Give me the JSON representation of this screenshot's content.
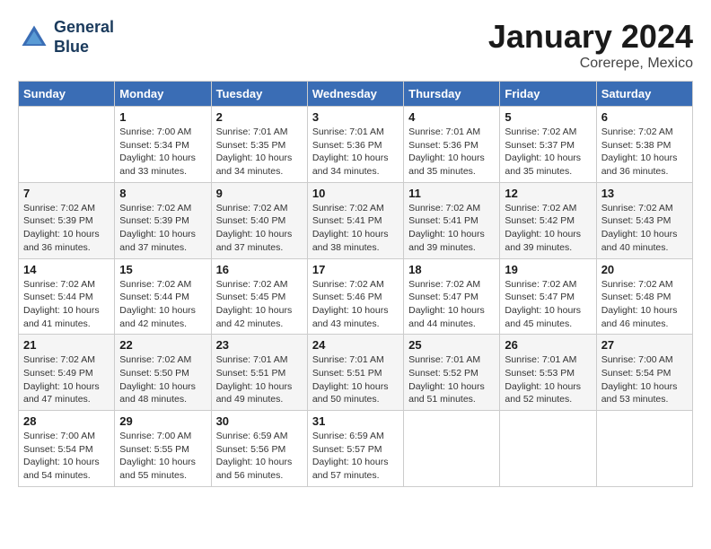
{
  "header": {
    "logo_line1": "General",
    "logo_line2": "Blue",
    "month_title": "January 2024",
    "location": "Corerepe, Mexico"
  },
  "weekdays": [
    "Sunday",
    "Monday",
    "Tuesday",
    "Wednesday",
    "Thursday",
    "Friday",
    "Saturday"
  ],
  "weeks": [
    [
      {
        "day": "",
        "sunrise": "",
        "sunset": "",
        "daylight": ""
      },
      {
        "day": "1",
        "sunrise": "Sunrise: 7:00 AM",
        "sunset": "Sunset: 5:34 PM",
        "daylight": "Daylight: 10 hours and 33 minutes."
      },
      {
        "day": "2",
        "sunrise": "Sunrise: 7:01 AM",
        "sunset": "Sunset: 5:35 PM",
        "daylight": "Daylight: 10 hours and 34 minutes."
      },
      {
        "day": "3",
        "sunrise": "Sunrise: 7:01 AM",
        "sunset": "Sunset: 5:36 PM",
        "daylight": "Daylight: 10 hours and 34 minutes."
      },
      {
        "day": "4",
        "sunrise": "Sunrise: 7:01 AM",
        "sunset": "Sunset: 5:36 PM",
        "daylight": "Daylight: 10 hours and 35 minutes."
      },
      {
        "day": "5",
        "sunrise": "Sunrise: 7:02 AM",
        "sunset": "Sunset: 5:37 PM",
        "daylight": "Daylight: 10 hours and 35 minutes."
      },
      {
        "day": "6",
        "sunrise": "Sunrise: 7:02 AM",
        "sunset": "Sunset: 5:38 PM",
        "daylight": "Daylight: 10 hours and 36 minutes."
      }
    ],
    [
      {
        "day": "7",
        "sunrise": "Sunrise: 7:02 AM",
        "sunset": "Sunset: 5:39 PM",
        "daylight": "Daylight: 10 hours and 36 minutes."
      },
      {
        "day": "8",
        "sunrise": "Sunrise: 7:02 AM",
        "sunset": "Sunset: 5:39 PM",
        "daylight": "Daylight: 10 hours and 37 minutes."
      },
      {
        "day": "9",
        "sunrise": "Sunrise: 7:02 AM",
        "sunset": "Sunset: 5:40 PM",
        "daylight": "Daylight: 10 hours and 37 minutes."
      },
      {
        "day": "10",
        "sunrise": "Sunrise: 7:02 AM",
        "sunset": "Sunset: 5:41 PM",
        "daylight": "Daylight: 10 hours and 38 minutes."
      },
      {
        "day": "11",
        "sunrise": "Sunrise: 7:02 AM",
        "sunset": "Sunset: 5:41 PM",
        "daylight": "Daylight: 10 hours and 39 minutes."
      },
      {
        "day": "12",
        "sunrise": "Sunrise: 7:02 AM",
        "sunset": "Sunset: 5:42 PM",
        "daylight": "Daylight: 10 hours and 39 minutes."
      },
      {
        "day": "13",
        "sunrise": "Sunrise: 7:02 AM",
        "sunset": "Sunset: 5:43 PM",
        "daylight": "Daylight: 10 hours and 40 minutes."
      }
    ],
    [
      {
        "day": "14",
        "sunrise": "Sunrise: 7:02 AM",
        "sunset": "Sunset: 5:44 PM",
        "daylight": "Daylight: 10 hours and 41 minutes."
      },
      {
        "day": "15",
        "sunrise": "Sunrise: 7:02 AM",
        "sunset": "Sunset: 5:44 PM",
        "daylight": "Daylight: 10 hours and 42 minutes."
      },
      {
        "day": "16",
        "sunrise": "Sunrise: 7:02 AM",
        "sunset": "Sunset: 5:45 PM",
        "daylight": "Daylight: 10 hours and 42 minutes."
      },
      {
        "day": "17",
        "sunrise": "Sunrise: 7:02 AM",
        "sunset": "Sunset: 5:46 PM",
        "daylight": "Daylight: 10 hours and 43 minutes."
      },
      {
        "day": "18",
        "sunrise": "Sunrise: 7:02 AM",
        "sunset": "Sunset: 5:47 PM",
        "daylight": "Daylight: 10 hours and 44 minutes."
      },
      {
        "day": "19",
        "sunrise": "Sunrise: 7:02 AM",
        "sunset": "Sunset: 5:47 PM",
        "daylight": "Daylight: 10 hours and 45 minutes."
      },
      {
        "day": "20",
        "sunrise": "Sunrise: 7:02 AM",
        "sunset": "Sunset: 5:48 PM",
        "daylight": "Daylight: 10 hours and 46 minutes."
      }
    ],
    [
      {
        "day": "21",
        "sunrise": "Sunrise: 7:02 AM",
        "sunset": "Sunset: 5:49 PM",
        "daylight": "Daylight: 10 hours and 47 minutes."
      },
      {
        "day": "22",
        "sunrise": "Sunrise: 7:02 AM",
        "sunset": "Sunset: 5:50 PM",
        "daylight": "Daylight: 10 hours and 48 minutes."
      },
      {
        "day": "23",
        "sunrise": "Sunrise: 7:01 AM",
        "sunset": "Sunset: 5:51 PM",
        "daylight": "Daylight: 10 hours and 49 minutes."
      },
      {
        "day": "24",
        "sunrise": "Sunrise: 7:01 AM",
        "sunset": "Sunset: 5:51 PM",
        "daylight": "Daylight: 10 hours and 50 minutes."
      },
      {
        "day": "25",
        "sunrise": "Sunrise: 7:01 AM",
        "sunset": "Sunset: 5:52 PM",
        "daylight": "Daylight: 10 hours and 51 minutes."
      },
      {
        "day": "26",
        "sunrise": "Sunrise: 7:01 AM",
        "sunset": "Sunset: 5:53 PM",
        "daylight": "Daylight: 10 hours and 52 minutes."
      },
      {
        "day": "27",
        "sunrise": "Sunrise: 7:00 AM",
        "sunset": "Sunset: 5:54 PM",
        "daylight": "Daylight: 10 hours and 53 minutes."
      }
    ],
    [
      {
        "day": "28",
        "sunrise": "Sunrise: 7:00 AM",
        "sunset": "Sunset: 5:54 PM",
        "daylight": "Daylight: 10 hours and 54 minutes."
      },
      {
        "day": "29",
        "sunrise": "Sunrise: 7:00 AM",
        "sunset": "Sunset: 5:55 PM",
        "daylight": "Daylight: 10 hours and 55 minutes."
      },
      {
        "day": "30",
        "sunrise": "Sunrise: 6:59 AM",
        "sunset": "Sunset: 5:56 PM",
        "daylight": "Daylight: 10 hours and 56 minutes."
      },
      {
        "day": "31",
        "sunrise": "Sunrise: 6:59 AM",
        "sunset": "Sunset: 5:57 PM",
        "daylight": "Daylight: 10 hours and 57 minutes."
      },
      {
        "day": "",
        "sunrise": "",
        "sunset": "",
        "daylight": ""
      },
      {
        "day": "",
        "sunrise": "",
        "sunset": "",
        "daylight": ""
      },
      {
        "day": "",
        "sunrise": "",
        "sunset": "",
        "daylight": ""
      }
    ]
  ]
}
